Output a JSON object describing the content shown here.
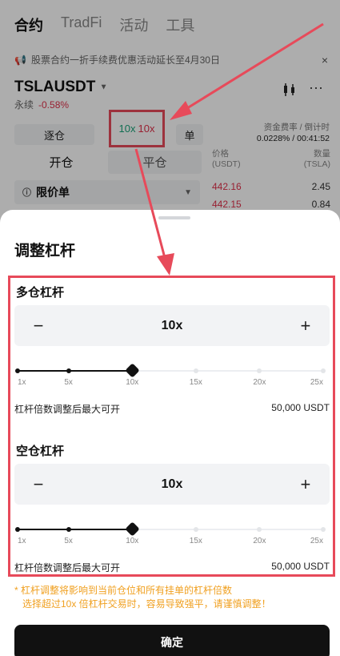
{
  "top_tabs": [
    "合约",
    "TradFi",
    "活动",
    "工具"
  ],
  "notice": {
    "text": "股票合约一折手续费优惠活动延长至4月30日",
    "close": "×"
  },
  "symbol": {
    "name": "TSLAUSDT",
    "type": "永续",
    "change": "-0.58%"
  },
  "pills": {
    "margin_mode": "逐仓",
    "lev_long": "10x",
    "lev_short": "10x",
    "single": "单"
  },
  "funding": {
    "label": "资金费率 / 倒计时",
    "value": "0.0228% / 00:41:52"
  },
  "trade_tabs": [
    "开仓",
    "平仓"
  ],
  "order_type": "限价单",
  "orderbook": {
    "col_price": "价格",
    "col_price_unit": "(USDT)",
    "col_qty": "数量",
    "col_qty_unit": "(TSLA)",
    "rows": [
      {
        "price": "442.16",
        "qty": "2.45"
      },
      {
        "price": "442.15",
        "qty": "0.84"
      }
    ]
  },
  "sheet": {
    "title": "调整杠杆",
    "long": {
      "label": "多仓杠杆",
      "value": "10x",
      "level": 10,
      "max_label": "杠杆倍数调整后最大可开",
      "max_value": "50,000 USDT"
    },
    "short": {
      "label": "空仓杠杆",
      "value": "10x",
      "level": 10,
      "max_label": "杠杆倍数调整后最大可开",
      "max_value": "50,000 USDT"
    },
    "ticks": [
      "1x",
      "5x",
      "10x",
      "15x",
      "20x",
      "25x"
    ],
    "minus": "−",
    "plus": "+",
    "warning_line1": "* 杠杆调整将影响到当前仓位和所有挂单的杠杆倍数",
    "warning_line2": "选择超过10x 倍杠杆交易时，容易导致强平，请谨慎调整！",
    "confirm": "确定"
  },
  "colors": {
    "highlight": "#e74a5a",
    "negative": "#e0304a",
    "positive": "#1aa37a",
    "warning": "#f0a020"
  }
}
